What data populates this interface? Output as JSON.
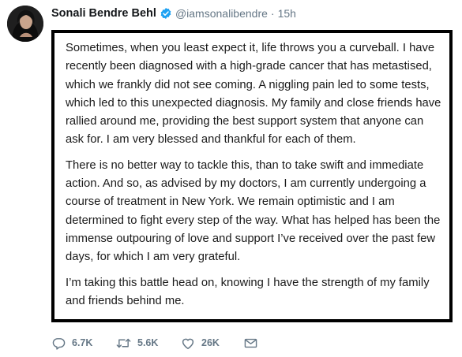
{
  "tweet": {
    "author": {
      "display_name": "Sonali Bendre Behl",
      "verified": true,
      "handle": "@iamsonalibendre",
      "separator": "·",
      "time": "15h"
    },
    "media_text": {
      "paragraphs": [
        "Sometimes, when you least expect it, life throws you a curveball. I have recently been diagnosed with a high-grade cancer that has metastised, which we frankly did not see coming. A niggling pain led to some tests, which led to this unexpected diagnosis.  My family and close friends have rallied around me, providing the best support system that anyone can ask for.  I am very blessed and thankful for each of them.",
        "There is no better way to tackle this, than to take swift and immediate action. And so, as advised by my doctors, I am currently undergoing a course of treatment in New York. We remain optimistic and I am determined to fight every step of the way. What has helped has been the immense outpouring of love and support I’ve received over the past few days, for which I am very grateful.",
        "I’m taking this battle head on, knowing I have the strength of my family and friends behind me."
      ]
    },
    "actions": {
      "replies": "6.7K",
      "retweets": "5.6K",
      "likes": "26K"
    }
  },
  "colors": {
    "name": "#14171a",
    "secondary": "#657786",
    "verified_blue": "#1da1f2",
    "frame_border": "#000000"
  },
  "icons": {
    "verified": "verified-badge-icon",
    "reply": "reply-icon",
    "retweet": "retweet-icon",
    "like": "heart-icon",
    "dm": "envelope-icon"
  }
}
